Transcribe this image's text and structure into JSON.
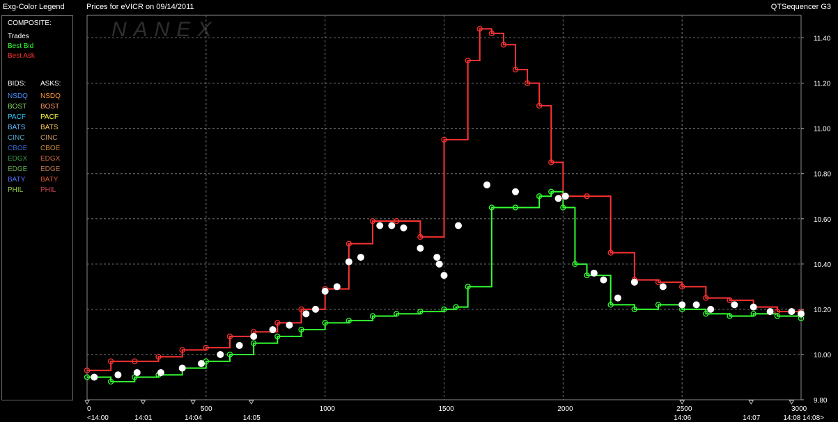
{
  "header": {
    "legend_title": "Exg-Color Legend",
    "chart_title": "Prices for  eVICR  on  09/14/2011",
    "app_name": "QTSequencer G3"
  },
  "watermark": "NANEX",
  "legend": {
    "composite_heading": "COMPOSITE:",
    "composite": [
      {
        "label": "Trades",
        "color": "#ffffff"
      },
      {
        "label": "Best Bid",
        "color": "#33ff33"
      },
      {
        "label": "Best Ask",
        "color": "#ff3333"
      }
    ],
    "bids_heading": "BIDS:",
    "asks_heading": "ASKS:",
    "exchanges": [
      {
        "bid": "NSDQ",
        "bid_color": "#4a90ff",
        "ask": "NSDQ",
        "ask_color": "#ff9933"
      },
      {
        "bid": "BOST",
        "bid_color": "#88dd66",
        "ask": "BOST",
        "ask_color": "#ff9966"
      },
      {
        "bid": "PACF",
        "bid_color": "#33ccff",
        "ask": "PACF",
        "ask_color": "#ffff44"
      },
      {
        "bid": "BATS",
        "bid_color": "#66bbff",
        "ask": "BATS",
        "ask_color": "#ffcc55"
      },
      {
        "bid": "CINC",
        "bid_color": "#55aacc",
        "ask": "CINC",
        "ask_color": "#cc9966"
      },
      {
        "bid": "CBOE",
        "bid_color": "#3366cc",
        "ask": "CBOE",
        "ask_color": "#cc8833"
      },
      {
        "bid": "EDGX",
        "bid_color": "#339944",
        "ask": "EDGX",
        "ask_color": "#cc6644"
      },
      {
        "bid": "EDGE",
        "bid_color": "#66aa55",
        "ask": "EDGE",
        "ask_color": "#bb7755"
      },
      {
        "bid": "BATY",
        "bid_color": "#5577ff",
        "ask": "BATY",
        "ask_color": "#dd5533"
      },
      {
        "bid": "PHIL",
        "bid_color": "#99cc44",
        "ask": "PHIL",
        "ask_color": "#cc4455"
      }
    ]
  },
  "chart_data": {
    "type": "line",
    "title": "Prices for  eVICR  on  09/14/2011",
    "xlabel": "",
    "ylabel": "",
    "xlim": [
      0,
      3000
    ],
    "ylim": [
      9.8,
      11.5
    ],
    "grid": true,
    "x_ticks": [
      0,
      500,
      1000,
      1500,
      2000,
      2500,
      3000
    ],
    "y_ticks": [
      9.8,
      10.0,
      10.2,
      10.4,
      10.6,
      10.8,
      11.0,
      11.2,
      11.4
    ],
    "y_tick_labels": [
      "9.80",
      "10.00",
      "10.20",
      "10.40",
      "10.60",
      "10.80",
      "11.00",
      "11.20",
      "11.40"
    ],
    "time_labels": [
      {
        "x": 0,
        "label": "<14:00"
      },
      {
        "x": 235,
        "label": "14:01"
      },
      {
        "x": 445,
        "label": "14:04"
      },
      {
        "x": 690,
        "label": "14:05"
      },
      {
        "x": 2500,
        "label": "14:06"
      },
      {
        "x": 2790,
        "label": "14:07"
      },
      {
        "x": 2960,
        "label": "14:08 14:08>"
      }
    ],
    "series": [
      {
        "name": "Best Ask",
        "color": "#ff3333",
        "x": [
          0,
          100,
          200,
          300,
          400,
          500,
          600,
          700,
          800,
          900,
          1000,
          1100,
          1200,
          1300,
          1400,
          1500,
          1600,
          1650,
          1700,
          1750,
          1800,
          1850,
          1900,
          1950,
          2000,
          2100,
          2200,
          2300,
          2400,
          2500,
          2600,
          2700,
          2800,
          2900,
          3000
        ],
        "y": [
          9.93,
          9.97,
          9.97,
          9.99,
          10.02,
          10.03,
          10.08,
          10.1,
          10.14,
          10.2,
          10.29,
          10.49,
          10.59,
          10.59,
          10.52,
          10.95,
          11.3,
          11.44,
          11.42,
          11.37,
          11.26,
          11.2,
          11.1,
          10.85,
          10.7,
          10.7,
          10.45,
          10.33,
          10.32,
          10.3,
          10.25,
          10.24,
          10.21,
          10.19,
          10.19
        ]
      },
      {
        "name": "Best Bid",
        "color": "#33ff33",
        "x": [
          0,
          100,
          200,
          300,
          400,
          500,
          600,
          700,
          800,
          900,
          1000,
          1100,
          1200,
          1300,
          1400,
          1500,
          1550,
          1600,
          1700,
          1800,
          1900,
          1950,
          2000,
          2050,
          2100,
          2200,
          2300,
          2400,
          2500,
          2600,
          2700,
          2800,
          2900,
          3000
        ],
        "y": [
          9.9,
          9.88,
          9.9,
          9.91,
          9.94,
          9.97,
          10.0,
          10.05,
          10.08,
          10.11,
          10.14,
          10.15,
          10.17,
          10.18,
          10.19,
          10.2,
          10.21,
          10.3,
          10.65,
          10.65,
          10.7,
          10.72,
          10.65,
          10.4,
          10.35,
          10.22,
          10.2,
          10.22,
          10.2,
          10.18,
          10.17,
          10.18,
          10.17,
          10.16
        ]
      },
      {
        "name": "Trades",
        "color": "#ffffff",
        "x": [
          30,
          130,
          210,
          310,
          400,
          480,
          560,
          640,
          700,
          780,
          850,
          920,
          960,
          1000,
          1050,
          1100,
          1150,
          1230,
          1280,
          1330,
          1400,
          1470,
          1480,
          1500,
          1560,
          1680,
          1800,
          1980,
          2010,
          2130,
          2170,
          2230,
          2300,
          2420,
          2500,
          2560,
          2620,
          2720,
          2800,
          2870,
          2960,
          3000
        ],
        "y": [
          9.9,
          9.91,
          9.92,
          9.92,
          9.94,
          9.96,
          10.0,
          10.04,
          10.08,
          10.11,
          10.13,
          10.18,
          10.2,
          10.28,
          10.3,
          10.41,
          10.43,
          10.57,
          10.57,
          10.56,
          10.47,
          10.43,
          10.4,
          10.35,
          10.57,
          10.75,
          10.72,
          10.69,
          10.7,
          10.36,
          10.33,
          10.25,
          10.32,
          10.3,
          10.22,
          10.22,
          10.2,
          10.22,
          10.21,
          10.19,
          10.19,
          10.18
        ]
      }
    ]
  }
}
